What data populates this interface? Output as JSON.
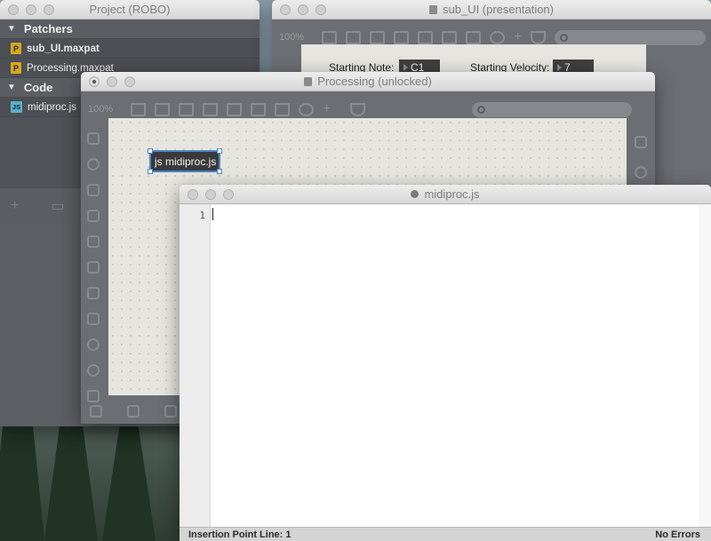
{
  "project_window": {
    "title": "Project (ROBO)",
    "groups": [
      {
        "label": "Patchers",
        "items": [
          {
            "badge": "P",
            "name": "sub_UI.maxpat",
            "selected": true
          },
          {
            "badge": "P",
            "name": "Processing.maxpat",
            "selected": false
          }
        ]
      },
      {
        "label": "Code",
        "items": [
          {
            "badge": "JS",
            "name": "midiproc.js",
            "selected": false
          }
        ]
      }
    ],
    "bottom_icons": [
      "plus-icon",
      "comment-icon"
    ]
  },
  "subui_window": {
    "title": "sub_UI (presentation)",
    "zoom": "100%",
    "controls": [
      {
        "label": "Starting Note:",
        "value": "C1"
      },
      {
        "label": "Starting Velocity:",
        "value": "7"
      }
    ]
  },
  "processing_window": {
    "title": "Processing (unlocked)",
    "zoom": "100%",
    "object_text": "js midiproc.js"
  },
  "editor_window": {
    "title": "midiproc.js",
    "line_numbers": [
      "1"
    ],
    "status_left": "Insertion Point Line: 1",
    "status_right": "No Errors"
  },
  "colors": {
    "selection_outline": "#4a87c8",
    "toolbar_bg": "#6b6e73",
    "badge_patcher": "#d8a81e",
    "badge_js": "#5ab0c9"
  }
}
